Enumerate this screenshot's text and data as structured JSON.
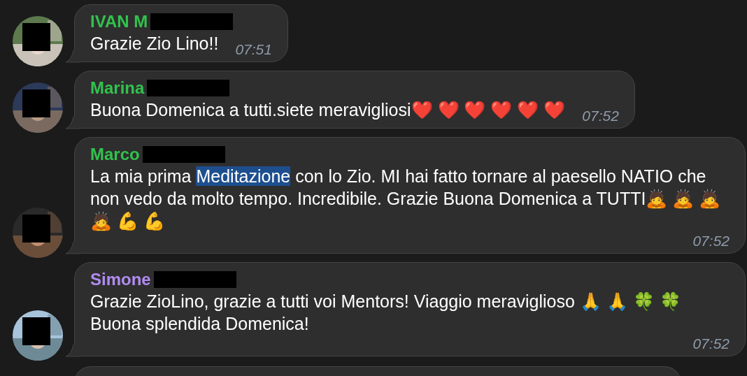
{
  "messages": [
    {
      "kind": "message",
      "sender": "IVAN M",
      "color": "#32c24d",
      "name_redacted": true,
      "avatar_redacted": true,
      "segments": [
        {
          "text": "Grazie Zio Lino!!",
          "highlighted": false
        }
      ],
      "time": "07:51"
    },
    {
      "kind": "message",
      "sender": "Marina",
      "color": "#32c24d",
      "name_redacted": true,
      "avatar_redacted": true,
      "segments": [
        {
          "text": "Buona Domenica a tutti.siete meravigliosi❤️ ❤️ ❤️ ❤️ ❤️ ❤️",
          "highlighted": false
        }
      ],
      "time": "07:52"
    },
    {
      "kind": "message",
      "sender": "Marco",
      "color": "#32c24d",
      "name_redacted": true,
      "avatar_redacted": true,
      "segments": [
        {
          "text": "La mia prima ",
          "highlighted": false
        },
        {
          "text": "Meditazione",
          "highlighted": true
        },
        {
          "text": " con lo Zio. MI hai fatto tornare al paesello NATIO che non vedo da molto tempo. Incredibile. Grazie Buona Domenica a TUTTI🙇 🙇 🙇 🙇 💪 💪",
          "highlighted": false
        }
      ],
      "time": "07:52"
    },
    {
      "kind": "message",
      "sender": "Simone",
      "color": "#b28cf2",
      "name_redacted": true,
      "avatar_redacted": true,
      "segments": [
        {
          "text": "Grazie ZioLino, grazie a tutti voi Mentors! Viaggio meraviglioso 🙏 🙏 🍀 🍀 Buona splendida Domenica!",
          "highlighted": false
        }
      ],
      "time": "07:52"
    },
    {
      "kind": "cut-off"
    }
  ]
}
